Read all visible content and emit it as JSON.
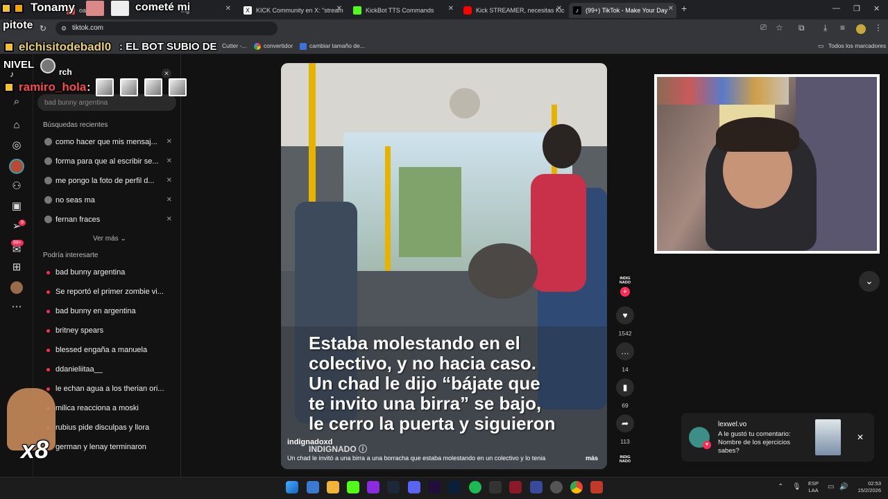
{
  "browser": {
    "tabs": [
      {
        "label": "oa",
        "color": "#e84d3d"
      },
      {
        "label": "ing",
        "color": "#4a4a4a"
      },
      {
        "label": "KICK Community en X: \"stream",
        "color": "#ffffff"
      },
      {
        "label": "KickBot TTS Commands",
        "color": "#53fc18"
      },
      {
        "label": "Kick STREAMER, necesitas Kick",
        "color": "#ff0000"
      },
      {
        "label": "(99+) TikTok - Make Your Day",
        "color": "#000000"
      }
    ],
    "url": "tiktok.com",
    "bookmarks": [
      {
        "label": "Cutter -..."
      },
      {
        "label": "convertidor"
      },
      {
        "label": "cambiar tamaño de..."
      }
    ],
    "all_bookmarks": "Todos los marcadores"
  },
  "overlay": {
    "top_name": "Tonamy",
    "top_message": "cometé mi",
    "channel": "pitote",
    "chat1_user": "elchisitodebadl0",
    "chat1_message": ": EL BOT SUBIO DE",
    "level": "NIVEL",
    "chat2_user": "ramiro_hola",
    "chat2_colon": ":",
    "multiplier": "x8"
  },
  "search": {
    "header_fragment": "rch",
    "placeholder": "bad bunny argentina",
    "recent_title": "Búsquedas recientes",
    "recent": [
      "como hacer que mis mensaj...",
      "forma para que al escribir se...",
      "me pongo la foto de perfil d...",
      "no seas ma",
      "fernan fraces"
    ],
    "see_more": "Ver más",
    "suggest_title": "Podría interesarte",
    "suggestions": [
      "bad bunny argentina",
      "Se reportó el primer zombie vi...",
      "bad bunny en argentina",
      "britney spears",
      "blessed engaña a manuela",
      "ddanieliitaa__",
      "le echan agua a los therian ori...",
      "milica reacciona a moski",
      "rubius pide disculpas y llora",
      "german y lenay terminaron"
    ]
  },
  "rail": {
    "explore_badge": "9",
    "inbox_badge": "99+"
  },
  "video": {
    "caption": "Estaba molestando en el\ncolectivo, y no hacia caso.\nUn chad le dijo “bájate que\nte invito una birra”  se bajo,\nle cerro la puerta y siguieron",
    "author": "indignadoxd",
    "author_overlay": "INDIGNADO ⓘ",
    "description": "Un chad le invitó a una birra a una borracha que estaba molestando en un colectivo y lo tenia",
    "more": "más"
  },
  "actions": {
    "avatar_label": "INDIG NADO",
    "likes": "1542",
    "comments": "14",
    "saves": "69",
    "shares": "113",
    "sound_label": "INDIG NADO"
  },
  "notification": {
    "user": "lexwel.vo",
    "text": "A le gustó tu comentario: Nombre de los ejercicios sabes?"
  },
  "taskbar": {
    "lang": "ESP",
    "lang_sub": "LAA",
    "time": "02:53",
    "date": "15/2/2026"
  }
}
